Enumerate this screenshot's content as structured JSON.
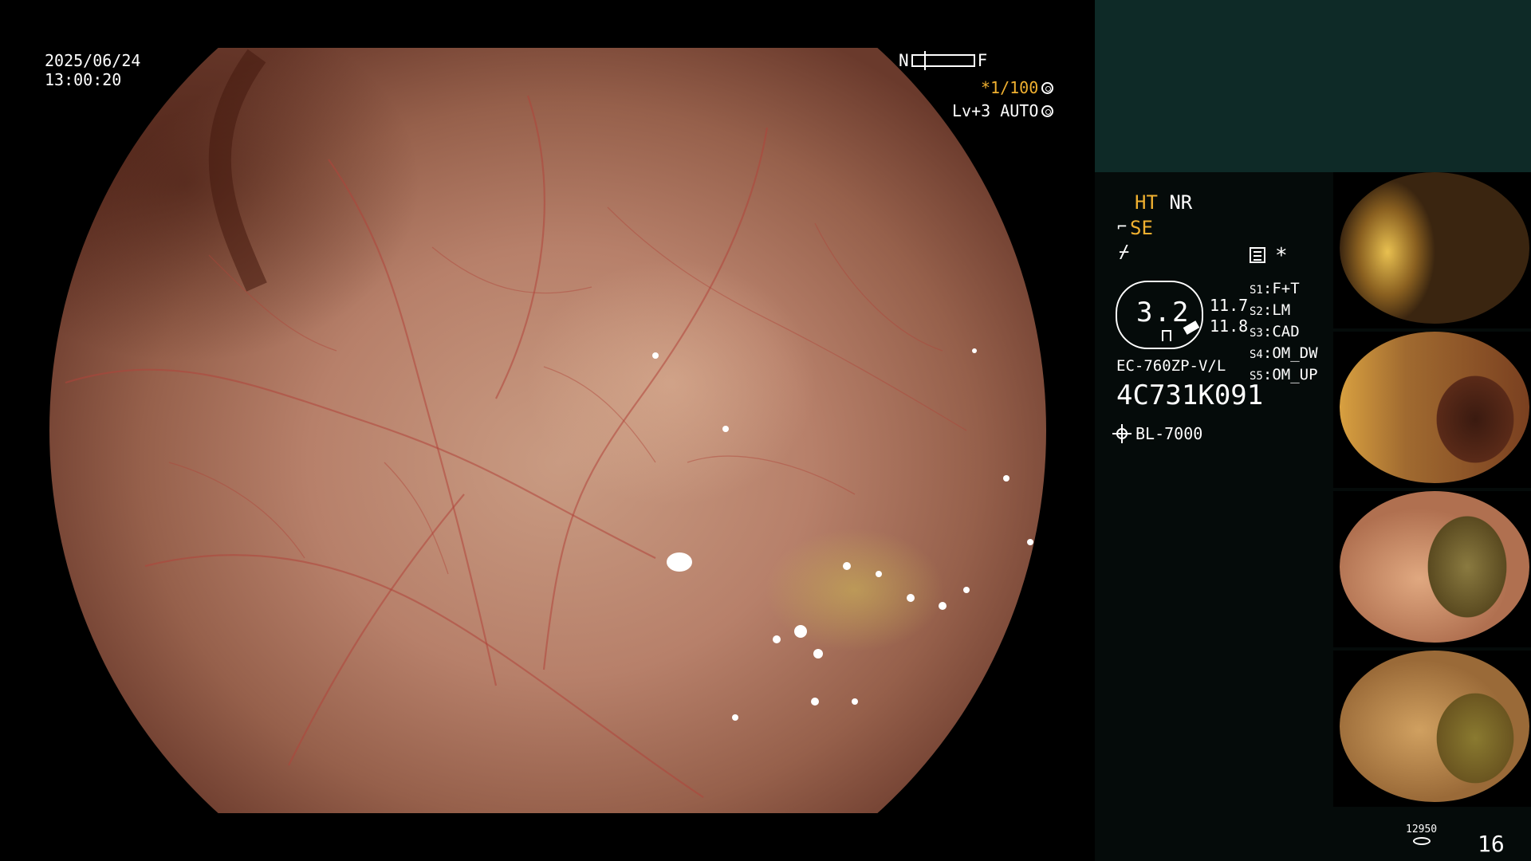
{
  "overlay": {
    "date": "2025/06/24",
    "time": "13:00:20",
    "nf_left": "N",
    "nf_right": "F",
    "shutter": "*1/100",
    "iris": "Lv+3 AUTO"
  },
  "panel": {
    "ht": "HT",
    "nr": "NR",
    "se": "SE",
    "zoom_value": "3.2",
    "num1": "11.7",
    "num2": "11.8",
    "scope_model": "EC-760ZP-V/L",
    "serial": "4C731K091",
    "light_source": "BL-7000",
    "switches": [
      {
        "key": "S1",
        "value": "F+T"
      },
      {
        "key": "S2",
        "value": "LM"
      },
      {
        "key": "S3",
        "value": "CAD"
      },
      {
        "key": "S4",
        "value": "OM_DW"
      },
      {
        "key": "S5",
        "value": "OM_UP"
      }
    ],
    "storage_value": "12950",
    "image_count": "16",
    "star": "*"
  },
  "colors": {
    "accent_orange": "#f0b030",
    "panel_top": "#0e2a27",
    "panel_bg": "#050b0a"
  }
}
